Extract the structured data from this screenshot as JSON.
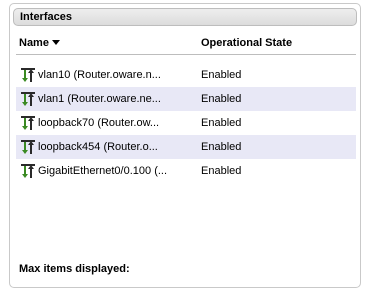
{
  "panel": {
    "title": "Interfaces"
  },
  "table": {
    "columns": [
      {
        "label": "Name"
      },
      {
        "label": "Operational State"
      }
    ],
    "rows": [
      {
        "name": "vlan10 (Router.oware.n...",
        "state": "Enabled"
      },
      {
        "name": "vlan1 (Router.oware.ne...",
        "state": "Enabled"
      },
      {
        "name": "loopback70 (Router.ow...",
        "state": "Enabled"
      },
      {
        "name": "loopback454 (Router.o...",
        "state": "Enabled"
      },
      {
        "name": "GigabitEthernet0/0.100 (...",
        "state": "Enabled"
      }
    ]
  },
  "footer": {
    "label": "Max items displayed:"
  },
  "icons": {
    "sort": "sort-descending-icon",
    "row": "network-interface-icon"
  },
  "colors": {
    "alt_row": "#e8e8f6",
    "icon_green": "#3a8a22",
    "icon_dark": "#2a2a2a"
  }
}
